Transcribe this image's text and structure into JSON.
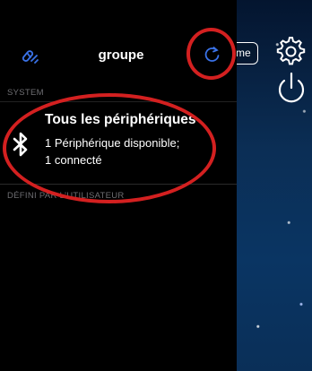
{
  "header": {
    "title": "groupe",
    "edit_icon": "link-edit-icon",
    "refresh_icon": "refresh-icon",
    "name_button_label": "me"
  },
  "sections": {
    "system": "SYSTEM",
    "user": "DÉFINI PAR L'UTILISATEUR"
  },
  "device": {
    "icon": "bluetooth-icon",
    "title": "Tous les périphériques",
    "line1": "1 Périphérique disponible;",
    "line2": "1 connecté"
  },
  "overlay": {
    "settings_icon": "gear-icon",
    "power_icon": "power-icon"
  },
  "colors": {
    "accent_blue": "#3a72e8",
    "annotation_red": "#d32020"
  }
}
